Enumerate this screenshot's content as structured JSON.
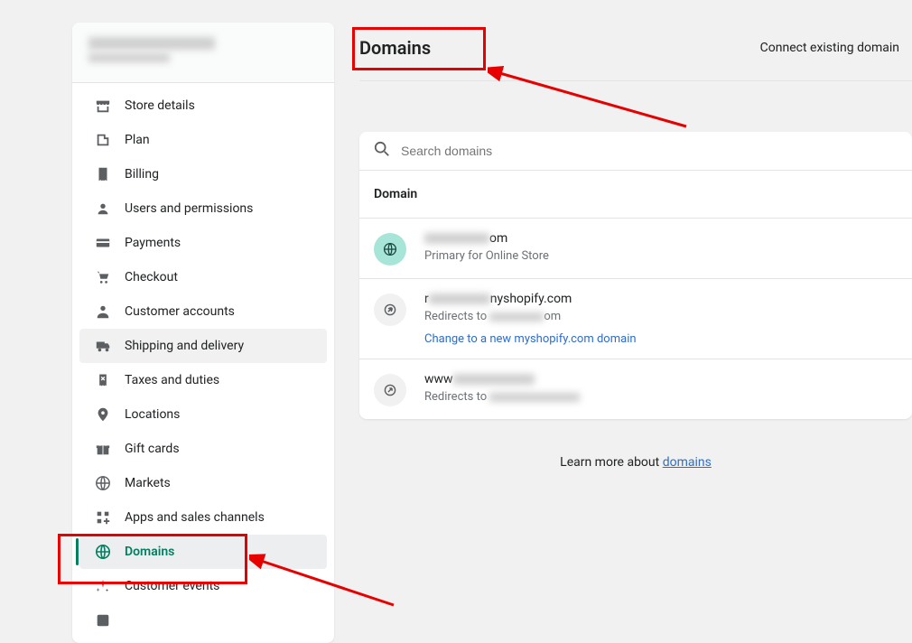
{
  "page": {
    "title": "Domains",
    "action": "Connect existing domain"
  },
  "search": {
    "placeholder": "Search domains"
  },
  "table": {
    "header": "Domain"
  },
  "rows": [
    {
      "name_suffix": "om",
      "sub": "Primary for Online Store"
    },
    {
      "name_suffix": "nyshopify.com",
      "sub_prefix": "Redirects to ",
      "sub_suffix": "om",
      "action": "Change to a new myshopify.com domain"
    },
    {
      "name_prefix": "www",
      "sub_prefix": "Redirects to "
    }
  ],
  "learn": {
    "prefix": "Learn more about ",
    "link": "domains"
  },
  "sidebar": {
    "items": [
      {
        "label": "Store details"
      },
      {
        "label": "Plan"
      },
      {
        "label": "Billing"
      },
      {
        "label": "Users and permissions"
      },
      {
        "label": "Payments"
      },
      {
        "label": "Checkout"
      },
      {
        "label": "Customer accounts"
      },
      {
        "label": "Shipping and delivery"
      },
      {
        "label": "Taxes and duties"
      },
      {
        "label": "Locations"
      },
      {
        "label": "Gift cards"
      },
      {
        "label": "Markets"
      },
      {
        "label": "Apps and sales channels"
      },
      {
        "label": "Domains"
      },
      {
        "label": "Customer events"
      }
    ]
  }
}
